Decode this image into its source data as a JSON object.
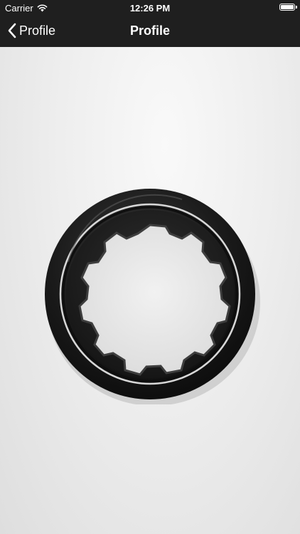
{
  "status_bar": {
    "carrier": "Carrier",
    "time": "12:26 PM",
    "wifi_icon": "wifi-icon",
    "battery_icon": "battery-icon"
  },
  "nav_bar": {
    "back_label": "Profile",
    "title": "Profile",
    "back_icon": "chevron-left-icon"
  },
  "content": {
    "image_subject": "black-rubber-ring-with-notched-inner-edge"
  },
  "colors": {
    "bar_background": "#1f1f1f",
    "bar_text": "#ffffff",
    "content_background": "#eeeeee",
    "ring": "#1e1e1e"
  }
}
